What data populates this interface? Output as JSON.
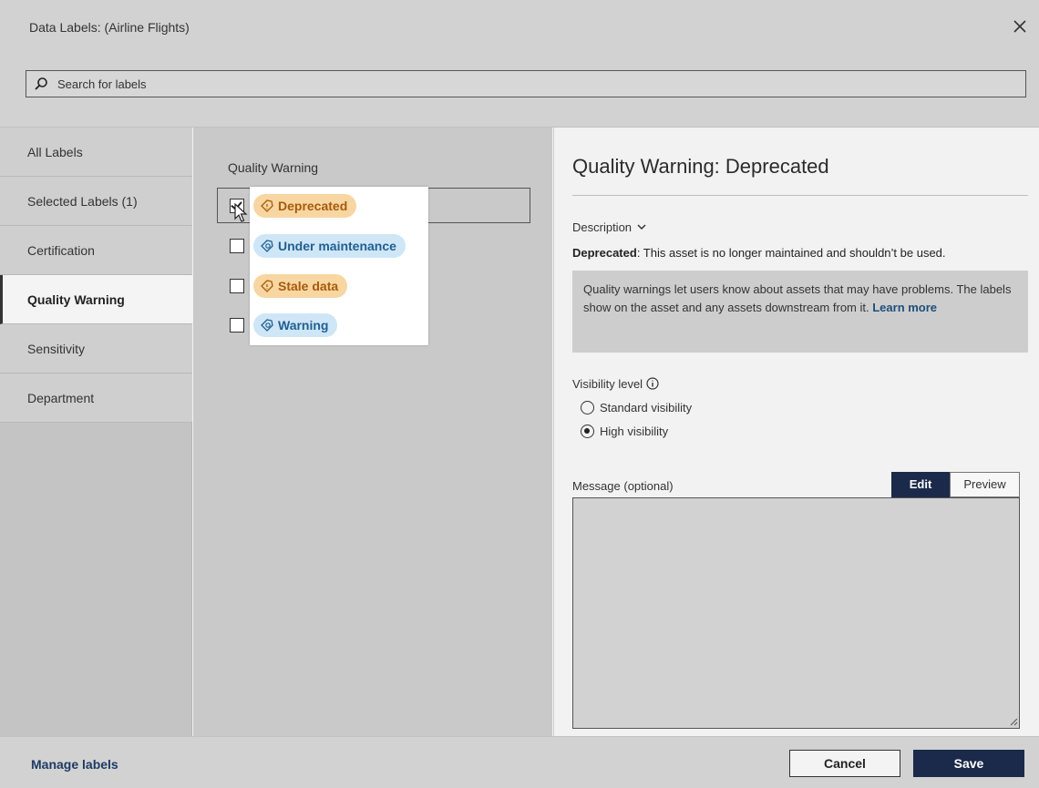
{
  "dialog": {
    "title": "Data Labels: (Airline Flights)",
    "close_icon": "close-icon"
  },
  "search": {
    "placeholder": "Search for labels",
    "value": ""
  },
  "nav": {
    "items": [
      {
        "label": "All Labels",
        "active": false
      },
      {
        "label": "Selected Labels (1)",
        "active": false
      },
      {
        "label": "Certification",
        "active": false
      },
      {
        "label": "Quality Warning",
        "active": true
      },
      {
        "label": "Sensitivity",
        "active": false
      },
      {
        "label": "Department",
        "active": false
      }
    ]
  },
  "middle": {
    "section_title": "Quality Warning",
    "labels": [
      {
        "label": "Deprecated",
        "checked": true,
        "color": "orange",
        "icon": "warning-tag-icon"
      },
      {
        "label": "Under maintenance",
        "checked": false,
        "color": "blue",
        "icon": "info-tag-icon"
      },
      {
        "label": "Stale data",
        "checked": false,
        "color": "orange",
        "icon": "warning-tag-icon"
      },
      {
        "label": "Warning",
        "checked": false,
        "color": "blue",
        "icon": "info-tag-icon"
      }
    ]
  },
  "detail": {
    "title": "Quality Warning: Deprecated",
    "description_toggle": "Description",
    "description_name": "Deprecated",
    "description_text": ": This asset is no longer maintained and shouldn’t be used.",
    "info_text": "Quality warnings let users know about assets that may have problems. The labels show on the asset and any assets downstream from it.",
    "learn_more": "Learn more",
    "visibility_label": "Visibility level",
    "visibility_options": [
      {
        "label": "Standard visibility",
        "selected": false
      },
      {
        "label": "High visibility",
        "selected": true
      }
    ],
    "message_label": "Message (optional)",
    "message_value": "",
    "tab_edit": "Edit",
    "tab_preview": "Preview"
  },
  "footer": {
    "manage_labels": "Manage labels",
    "cancel": "Cancel",
    "save": "Save"
  },
  "colors": {
    "accent_dark": "#1b2a4a",
    "pill_orange_bg": "#f7d6a2",
    "pill_orange_text": "#a85a0a",
    "pill_blue_bg": "#cfe6f7",
    "pill_blue_text": "#1f5f91"
  }
}
